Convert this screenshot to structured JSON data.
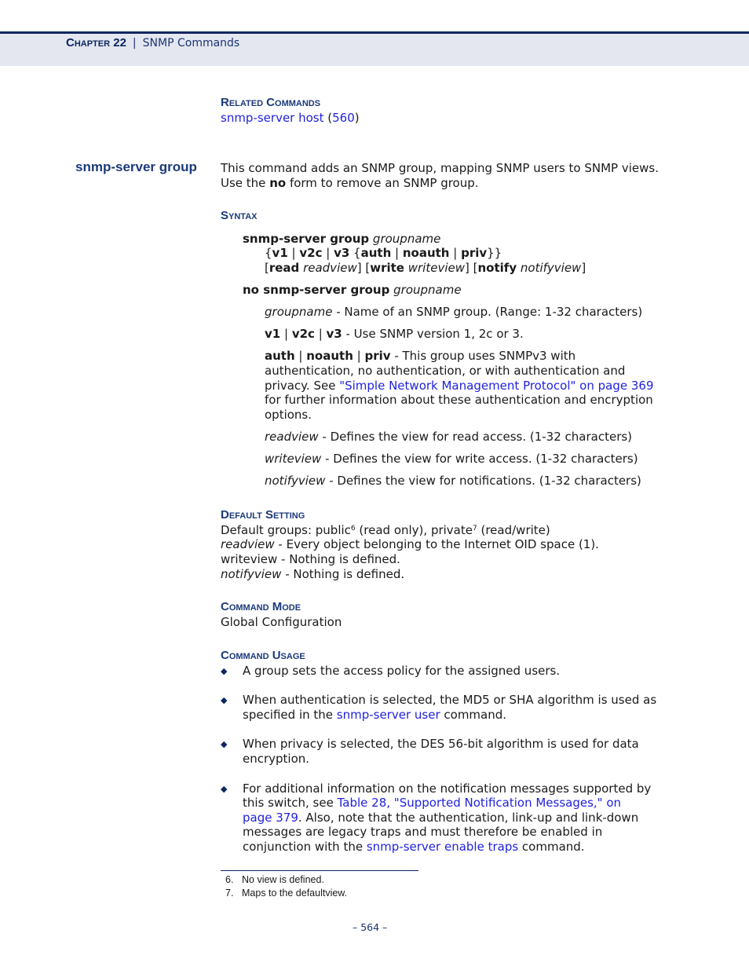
{
  "header": {
    "chapter": "Chapter 22",
    "separator": "|",
    "title": "SNMP Commands"
  },
  "related_commands": {
    "heading": "Related Commands",
    "link_text": "snmp-server host",
    "open_paren": "(",
    "page_link": "560",
    "close_paren": ")"
  },
  "command": {
    "name": "snmp-server group",
    "description_line1": "This command adds an SNMP group, mapping SNMP users to SNMP views.",
    "desc2_pre": "Use the ",
    "desc2_bold": "no",
    "desc2_post": " form to remove an SNMP group."
  },
  "syntax": {
    "heading": "Syntax",
    "l1_bold": "snmp-server group",
    "l1_ital": "groupname",
    "l2": [
      "{",
      "v1",
      " | ",
      "v2c",
      " | ",
      "v3",
      " {",
      "auth",
      " | ",
      "noauth",
      " | ",
      "priv",
      "}}"
    ],
    "l3": [
      "[",
      "read",
      " ",
      "readview",
      "] [",
      "write",
      " ",
      "writeview",
      "] [",
      "notify",
      " ",
      "notifyview",
      "]"
    ],
    "no_bold": "no snmp-server group",
    "no_ital": "groupname",
    "params": {
      "groupname_term": "groupname",
      "groupname_desc": " - Name of an SNMP group. (Range: 1-32 characters)",
      "ver": [
        "v1",
        " | ",
        "v2c",
        " | ",
        "v3",
        " - Use SNMP version 1, 2c or 3."
      ],
      "auth": [
        "auth",
        " | ",
        "noauth",
        " | ",
        "priv",
        " - This group uses SNMPv3 with"
      ],
      "auth_l2": "authentication, no authentication, or with authentication and",
      "auth_l3_pre": "privacy. See ",
      "auth_l3_link": "\"Simple Network Management Protocol\" on page 369",
      "auth_l4": "for further information about these authentication and encryption",
      "auth_l5": "options.",
      "readview_term": "readview",
      "readview_desc": " - Defines the view for read access. (1-32 characters)",
      "writeview_term": "writeview",
      "writeview_desc": " - Defines the view for write access. (1-32 characters)",
      "notifyview_term": "notifyview",
      "notifyview_desc": " - Defines the view for notifications. (1-32 characters)"
    }
  },
  "default_setting": {
    "heading": "Default Setting",
    "l1_a": "Default groups: public",
    "l1_sup1": "6",
    "l1_b": " (read only), private",
    "l1_sup2": "7",
    "l1_c": " (read/write)",
    "l2_term": "readview",
    "l2_desc": " - Every object belonging to the Internet OID space (1).",
    "l3": "writeview - Nothing is defined.",
    "l4_term": "notifyview",
    "l4_desc": " - Nothing is defined."
  },
  "command_mode": {
    "heading": "Command Mode",
    "value": "Global Configuration"
  },
  "command_usage": {
    "heading": "Command Usage",
    "bullet_glyph": "◆",
    "b1": "A group sets the access policy for the assigned users.",
    "b2_l1": "When authentication is selected, the MD5 or SHA algorithm is used as",
    "b2_l2_pre": "specified in the ",
    "b2_l2_link": "snmp-server user",
    "b2_l2_post": " command.",
    "b3_l1": "When privacy is selected, the DES 56-bit algorithm is used for data",
    "b3_l2": "encryption.",
    "b4_l1": "For additional information on the notification messages supported by",
    "b4_l2_pre": "this switch, see ",
    "b4_l2_link": "Table 28, \"Supported Notification Messages,\" on",
    "b4_l3_link": "page 379",
    "b4_l3_post": ". Also, note that the authentication, link-up and link-down",
    "b4_l4": "messages are legacy traps and must therefore be enabled in",
    "b4_l5_pre": "conjunction with the ",
    "b4_l5_link": "snmp-server enable traps",
    "b4_l5_post": " command."
  },
  "footnotes": [
    {
      "num": "6.",
      "text": "No view is defined."
    },
    {
      "num": "7.",
      "text": "Maps to the defaultview."
    }
  ],
  "page_number": "–  564  –"
}
